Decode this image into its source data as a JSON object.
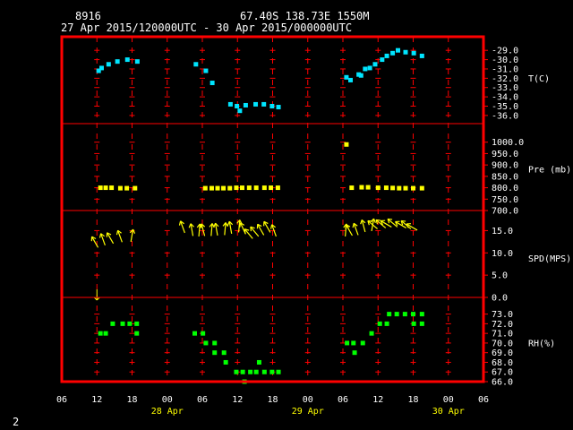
{
  "header": {
    "station": "8916",
    "location": "67.40S 138.73E 1550M",
    "period": "27 Apr 2015/120000UTC - 30 Apr 2015/000000UTC"
  },
  "footer": {
    "page_number": "2"
  },
  "colors": {
    "frame": "#ff0000",
    "grid": "#ff0000",
    "temperature": "#00e5ff",
    "pressure": "#ffff00",
    "wind": "#ffff00",
    "humidity": "#00ff00",
    "text": "#ffffff",
    "date_labels": "#ffff00"
  },
  "chart_data": {
    "type": "scatter",
    "x_axis": {
      "ticks": [
        {
          "h": 6,
          "label": "06"
        },
        {
          "h": 12,
          "label": "12"
        },
        {
          "h": 18,
          "label": "18"
        },
        {
          "h": 24,
          "label": "00"
        },
        {
          "h": 30,
          "label": "06"
        },
        {
          "h": 36,
          "label": "12"
        },
        {
          "h": 42,
          "label": "18"
        },
        {
          "h": 48,
          "label": "00"
        },
        {
          "h": 54,
          "label": "06"
        },
        {
          "h": 60,
          "label": "12"
        },
        {
          "h": 66,
          "label": "18"
        },
        {
          "h": 72,
          "label": "00"
        },
        {
          "h": 78,
          "label": "06"
        }
      ],
      "dates": [
        {
          "h": 24,
          "label": "28 Apr"
        },
        {
          "h": 48,
          "label": "29 Apr"
        },
        {
          "h": 72,
          "label": "30 Apr"
        }
      ],
      "range": [
        6,
        78
      ]
    },
    "panels": [
      {
        "key": "temperature",
        "label": "T(C)",
        "ylim": [
          -36.3,
          -28.5
        ],
        "ticks": [
          {
            "v": -29,
            "label": "-29.0"
          },
          {
            "v": -30,
            "label": "-30.0"
          },
          {
            "v": -31,
            "label": "-31.0"
          },
          {
            "v": -32,
            "label": "-32.0"
          },
          {
            "v": -33,
            "label": "-33.0"
          },
          {
            "v": -34,
            "label": "-34.0"
          },
          {
            "v": -35,
            "label": "-35.0"
          },
          {
            "v": -36,
            "label": "-36.0"
          }
        ],
        "label_value": -32,
        "points": [
          [
            12.3,
            -31.2
          ],
          [
            12.8,
            -30.9
          ],
          [
            14,
            -30.5
          ],
          [
            15.5,
            -30.2
          ],
          [
            17.2,
            -30.0
          ],
          [
            18.9,
            -30.2
          ],
          [
            28.9,
            -30.5
          ],
          [
            30.6,
            -31.2
          ],
          [
            31.7,
            -32.5
          ],
          [
            34.8,
            -34.8
          ],
          [
            35.9,
            -35.0
          ],
          [
            36.4,
            -35.5
          ],
          [
            37.4,
            -34.9
          ],
          [
            39.1,
            -34.8
          ],
          [
            40.5,
            -34.8
          ],
          [
            41.9,
            -35.0
          ],
          [
            43.0,
            -35.1
          ],
          [
            54.6,
            -31.9
          ],
          [
            55.3,
            -32.2
          ],
          [
            56.7,
            -31.6
          ],
          [
            57.1,
            -31.7
          ],
          [
            57.8,
            -31.0
          ],
          [
            58.6,
            -30.9
          ],
          [
            59.5,
            -30.5
          ],
          [
            60.7,
            -30.0
          ],
          [
            61.5,
            -29.6
          ],
          [
            62.5,
            -29.3
          ],
          [
            63.4,
            -29.0
          ],
          [
            64.7,
            -29.2
          ],
          [
            66.1,
            -29.3
          ],
          [
            67.5,
            -29.6
          ]
        ]
      },
      {
        "key": "pressure",
        "label": "Pre (mb)",
        "ylim": [
          700,
          1050
        ],
        "ticks": [
          {
            "v": 1000,
            "label": "1000.0"
          },
          {
            "v": 950,
            "label": "950.0"
          },
          {
            "v": 900,
            "label": "900.0"
          },
          {
            "v": 850,
            "label": "850.0"
          },
          {
            "v": 800,
            "label": "800.0"
          },
          {
            "v": 750,
            "label": "750.0"
          },
          {
            "v": 700,
            "label": "700.0"
          }
        ],
        "label_value": 880,
        "points": [
          [
            12.6,
            800
          ],
          [
            13.5,
            800
          ],
          [
            14.5,
            800
          ],
          [
            16.0,
            798
          ],
          [
            17.1,
            798
          ],
          [
            18.5,
            798
          ],
          [
            30.5,
            798
          ],
          [
            31.6,
            798
          ],
          [
            32.6,
            798
          ],
          [
            33.6,
            798
          ],
          [
            34.7,
            798
          ],
          [
            35.8,
            800
          ],
          [
            36.8,
            800
          ],
          [
            38.0,
            800
          ],
          [
            39.2,
            800
          ],
          [
            40.6,
            800
          ],
          [
            41.7,
            800
          ],
          [
            42.9,
            800
          ],
          [
            54.6,
            990
          ],
          [
            55.5,
            800
          ],
          [
            57.2,
            802
          ],
          [
            58.3,
            802
          ],
          [
            60.0,
            800
          ],
          [
            61.4,
            800
          ],
          [
            62.5,
            799
          ],
          [
            63.6,
            798
          ],
          [
            64.7,
            798
          ],
          [
            66.0,
            798
          ],
          [
            67.5,
            798
          ]
        ]
      },
      {
        "key": "wind",
        "label": "SPD(MPS)",
        "ylim": [
          0,
          17.5
        ],
        "ticks": [
          {
            "v": 15,
            "label": "15.0"
          },
          {
            "v": 10,
            "label": "10.0"
          },
          {
            "v": 5,
            "label": "5.0"
          },
          {
            "v": 0,
            "label": "0.0"
          }
        ],
        "label_value": 8.8,
        "points": [
          [
            12.2,
            11.2,
            330
          ],
          [
            13.4,
            11.7,
            340
          ],
          [
            14.8,
            12.1,
            330
          ],
          [
            16.3,
            12.4,
            340
          ],
          [
            17.8,
            12.5,
            10
          ],
          [
            27.0,
            14.5,
            340
          ],
          [
            28.4,
            13.8,
            350
          ],
          [
            29.4,
            13.7,
            5
          ],
          [
            30.4,
            13.8,
            345
          ],
          [
            31.5,
            13.8,
            5
          ],
          [
            32.6,
            13.9,
            350
          ],
          [
            33.8,
            14.0,
            5
          ],
          [
            35.0,
            14.3,
            350
          ],
          [
            36.2,
            14.6,
            5
          ],
          [
            37.4,
            14.2,
            335
          ],
          [
            38.6,
            13.2,
            320
          ],
          [
            39.6,
            13.7,
            320
          ],
          [
            40.5,
            14.0,
            330
          ],
          [
            41.6,
            14.6,
            330
          ],
          [
            42.6,
            13.7,
            340
          ],
          [
            54.4,
            13.7,
            5
          ],
          [
            55.6,
            13.9,
            330
          ],
          [
            56.6,
            14.0,
            340
          ],
          [
            57.8,
            14.7,
            345
          ],
          [
            58.9,
            14.9,
            10
          ],
          [
            59.9,
            15.4,
            310
          ],
          [
            61.3,
            15.6,
            310
          ],
          [
            62.3,
            15.8,
            300
          ],
          [
            63.3,
            15.8,
            310
          ],
          [
            64.8,
            15.6,
            300
          ],
          [
            65.6,
            15.4,
            310
          ],
          [
            66.7,
            15.1,
            300
          ]
        ],
        "annotation": {
          "x": 12.0,
          "y": 0,
          "dir": 180
        }
      },
      {
        "key": "humidity",
        "label": "RH(%)",
        "ylim": [
          66,
          73.8
        ],
        "ticks": [
          {
            "v": 73,
            "label": "73.0"
          },
          {
            "v": 72,
            "label": "72.0"
          },
          {
            "v": 71,
            "label": "71.0"
          },
          {
            "v": 70,
            "label": "70.0"
          },
          {
            "v": 69,
            "label": "69.0"
          },
          {
            "v": 68,
            "label": "68.0"
          },
          {
            "v": 67,
            "label": "67.0"
          },
          {
            "v": 66,
            "label": "66.0"
          }
        ],
        "label_value": 70,
        "points": [
          [
            12.6,
            71
          ],
          [
            13.5,
            71
          ],
          [
            14.7,
            72
          ],
          [
            16.4,
            72
          ],
          [
            17.6,
            72
          ],
          [
            18.8,
            72
          ],
          [
            18.8,
            71
          ],
          [
            28.7,
            71
          ],
          [
            30.1,
            71
          ],
          [
            30.6,
            70
          ],
          [
            32.1,
            70
          ],
          [
            32.1,
            69
          ],
          [
            33.7,
            69
          ],
          [
            34.0,
            68
          ],
          [
            35.8,
            67
          ],
          [
            36.9,
            67
          ],
          [
            37.2,
            66
          ],
          [
            38.2,
            67
          ],
          [
            39.2,
            67
          ],
          [
            39.7,
            68
          ],
          [
            40.6,
            67
          ],
          [
            41.9,
            67
          ],
          [
            43.0,
            67
          ],
          [
            54.7,
            70
          ],
          [
            55.8,
            70
          ],
          [
            56.0,
            69
          ],
          [
            57.4,
            70
          ],
          [
            58.9,
            71
          ],
          [
            60.3,
            72
          ],
          [
            61.5,
            72
          ],
          [
            61.9,
            73
          ],
          [
            63.2,
            73
          ],
          [
            64.6,
            73
          ],
          [
            66.0,
            73
          ],
          [
            67.5,
            73
          ],
          [
            67.5,
            72
          ],
          [
            66.1,
            72
          ]
        ]
      }
    ]
  }
}
